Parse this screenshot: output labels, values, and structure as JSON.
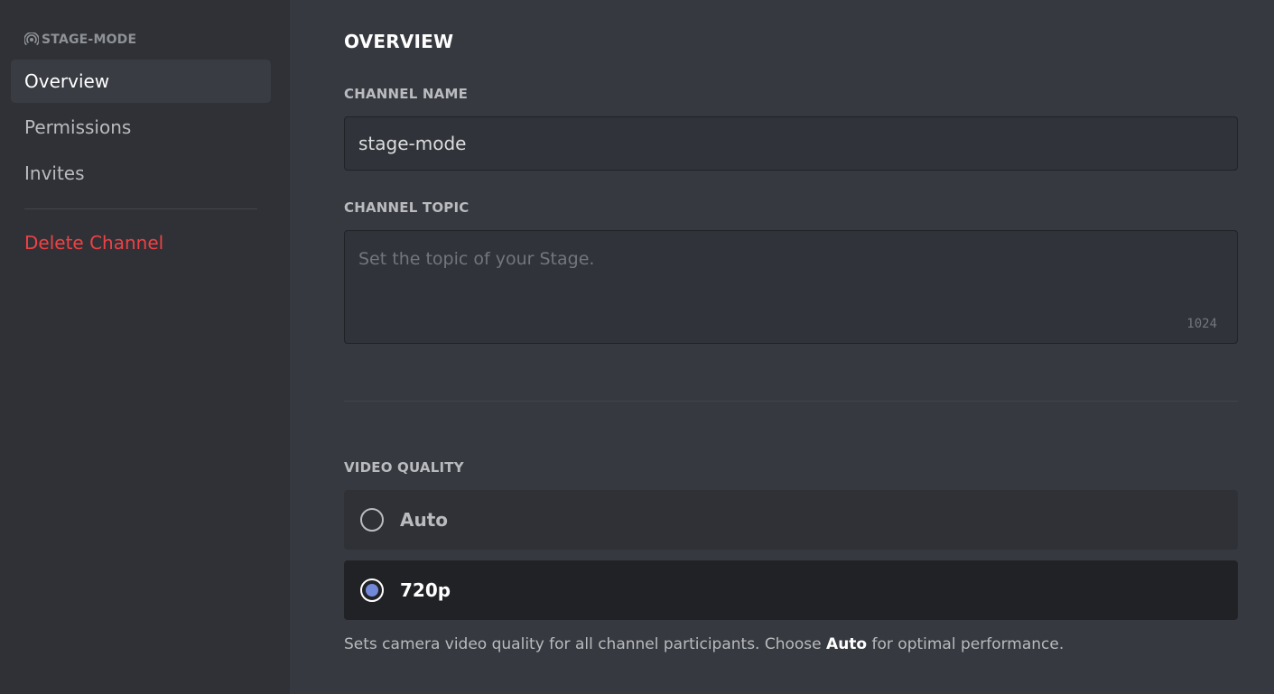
{
  "sidebar": {
    "header": "STAGE-MODE",
    "header_icon": "stage-icon",
    "items": [
      {
        "label": "Overview",
        "selected": true
      },
      {
        "label": "Permissions",
        "selected": false
      },
      {
        "label": "Invites",
        "selected": false
      }
    ],
    "delete_label": "Delete Channel"
  },
  "main": {
    "title": "OVERVIEW",
    "channel_name": {
      "label": "CHANNEL NAME",
      "value": "stage-mode"
    },
    "channel_topic": {
      "label": "CHANNEL TOPIC",
      "placeholder": "Set the topic of your Stage.",
      "value": "",
      "counter": "1024"
    },
    "video_quality": {
      "label": "VIDEO QUALITY",
      "options": [
        {
          "label": "Auto",
          "selected": false
        },
        {
          "label": "720p",
          "selected": true
        }
      ],
      "help_before": "Sets camera video quality for all channel participants. Choose ",
      "help_bold": "Auto",
      "help_after": " for optimal performance."
    }
  },
  "colors": {
    "accent": "#7289da",
    "danger": "#ed4245",
    "sidebar_bg": "#2f3136",
    "main_bg": "#36393f"
  }
}
